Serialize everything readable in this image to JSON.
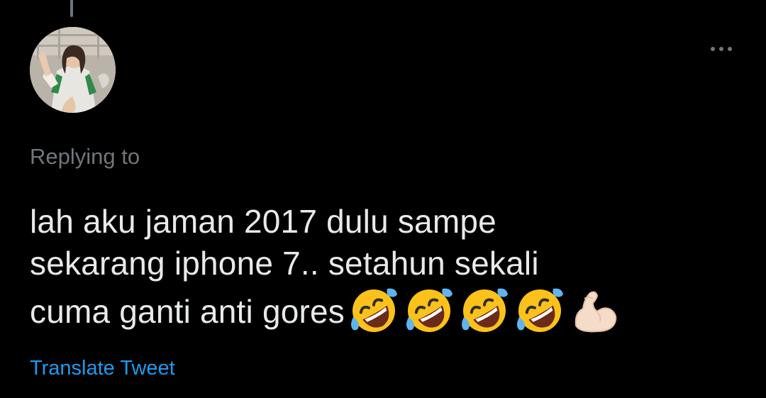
{
  "tweet": {
    "replying_label": "Replying to",
    "text_lines": [
      "lah aku jaman 2017 dulu sampe",
      "sekarang iphone 7.. setahun sekali",
      "cuma ganti anti gores"
    ],
    "emojis": [
      "rolling-on-floor-laughing",
      "rolling-on-floor-laughing",
      "rolling-on-floor-laughing",
      "rolling-on-floor-laughing",
      "flexed-biceps"
    ],
    "translate_label": "Translate Tweet"
  },
  "colors": {
    "background": "#000000",
    "text": "#e7e9ea",
    "secondary_text": "#71767b",
    "link": "#1d9bf0",
    "thread_line": "#6e767d"
  },
  "icons": {
    "more": "more-dots-icon",
    "avatar": "user-avatar"
  }
}
